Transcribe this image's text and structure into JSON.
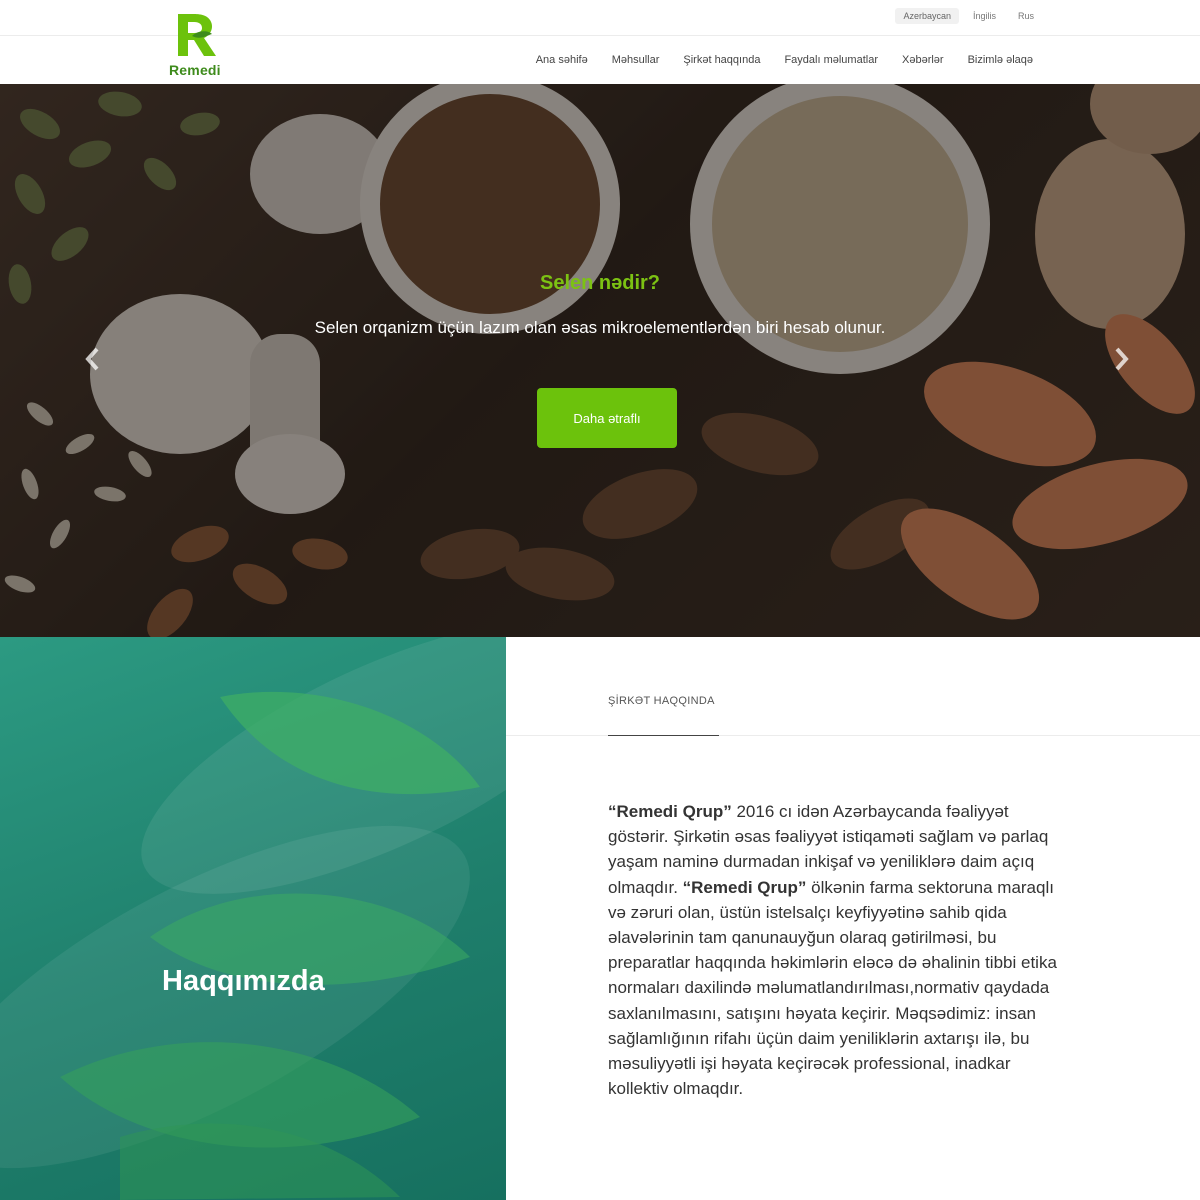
{
  "brand": {
    "name": "Remedi",
    "green": "#6cc20c",
    "dark_green": "#3e8b1c"
  },
  "languages": [
    {
      "label": "Azerbaycan",
      "active": true
    },
    {
      "label": "İngilis",
      "active": false
    },
    {
      "label": "Rus",
      "active": false
    }
  ],
  "nav": [
    {
      "label": "Ana səhifə"
    },
    {
      "label": "Məhsullar"
    },
    {
      "label": "Şirkət haqqında"
    },
    {
      "label": "Faydalı məlumatlar"
    },
    {
      "label": "Xəbərlər"
    },
    {
      "label": "Bizimlə əlaqə"
    }
  ],
  "hero": {
    "title": "Selen nədir?",
    "text": "Selen orqanizm üçün lazım olan əsas mikroelementlərdən biri hesab olunur.",
    "button": "Daha ətraflı",
    "prev_icon": "chevron-left-icon",
    "next_icon": "chevron-right-icon"
  },
  "about": {
    "heading": "Haqqımızda",
    "section_label": "ŞİRKƏT HAQQINDA",
    "body": {
      "brand_quote_1": "“Remedi Qrup”",
      "part_1": " 2016 cı idən Azərbaycanda fəaliyyət göstərir. Şirkətin əsas fəaliyyət istiqaməti sağlam və parlaq yaşam naminə durmadan inkişaf və yeniliklərə daim açıq olmaqdır. ",
      "brand_quote_2": "“Remedi Qrup”",
      "part_2": " ölkənin farma sektoruna maraqlı və zəruri olan, üstün istelsalçı keyfiyyətinə sahib qida əlavələrinin tam qanunauyğun olaraq gətirilməsi, bu preparatlar haqqında həkimlərin eləcə də əhalinin tibbi etika normaları daxilində məlumatlandırılması,normativ qaydada saxlanılmasını, satışını həyata keçirir. Məqsədimiz: insan sağlamlığının rifahı üçün daim yeniliklərin axtarışı ilə, bu məsuliyyətli işi həyata keçirəcək professional, inadkar kollektiv olmaqdır."
    }
  }
}
